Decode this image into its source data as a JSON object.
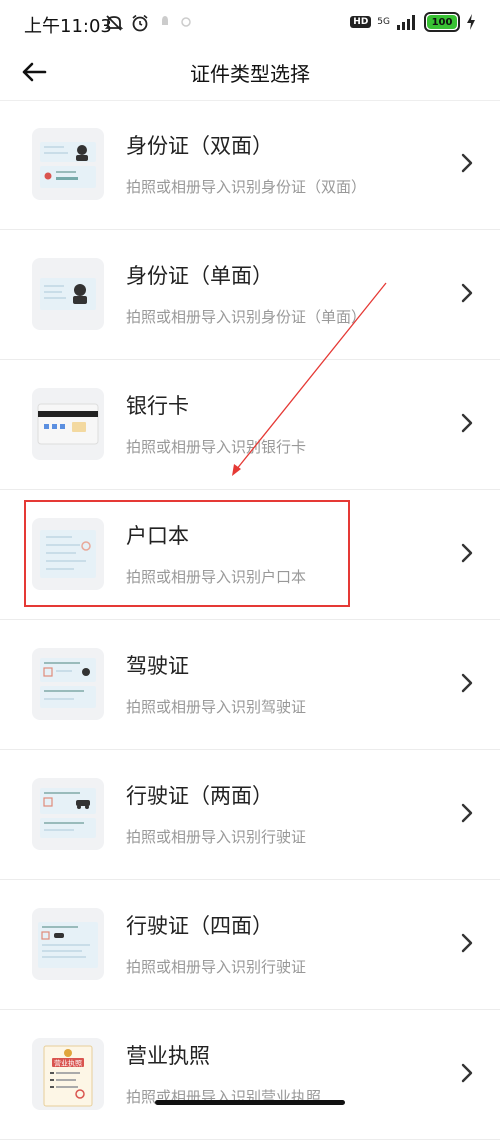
{
  "status_bar": {
    "time": "上午11:03",
    "hd": "HD",
    "network": "5G",
    "battery": "100"
  },
  "header": {
    "title": "证件类型选择"
  },
  "items": [
    {
      "title": "身份证（双面）",
      "subtitle": "拍照或相册导入识别身份证（双面）"
    },
    {
      "title": "身份证（单面）",
      "subtitle": "拍照或相册导入识别身份证（单面）"
    },
    {
      "title": "银行卡",
      "subtitle": "拍照或相册导入识别银行卡"
    },
    {
      "title": "户口本",
      "subtitle": "拍照或相册导入识别户口本"
    },
    {
      "title": "驾驶证",
      "subtitle": "拍照或相册导入识别驾驶证"
    },
    {
      "title": "行驶证（两面）",
      "subtitle": "拍照或相册导入识别行驶证"
    },
    {
      "title": "行驶证（四面）",
      "subtitle": "拍照或相册导入识别行驶证"
    },
    {
      "title": "营业执照",
      "subtitle": "拍照或相册导入识别营业执照"
    }
  ],
  "colors": {
    "highlight": "#e53935",
    "battery": "#39c234"
  }
}
